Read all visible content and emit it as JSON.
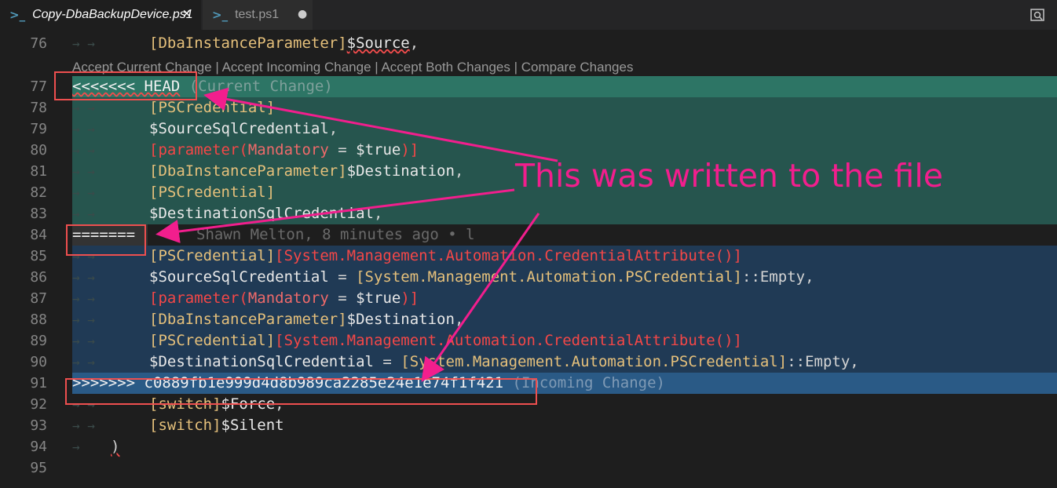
{
  "tabs": [
    {
      "icon": "powershell-icon",
      "title": "Copy-DbaBackupDevice.ps1",
      "close": "✕"
    },
    {
      "icon": "powershell-icon",
      "title": "test.ps1",
      "dirty": "●"
    }
  ],
  "codelens": "Accept Current Change | Accept Incoming Change | Accept Both Changes | Compare Changes",
  "lines": {
    "l76": {
      "num": "76",
      "type": "[DbaInstanceParameter]",
      "var": "$Source",
      "tail": ","
    },
    "l77": {
      "num": "77",
      "marker": "<<<<<<< HEAD",
      "label": "(Current Change)"
    },
    "l78": {
      "num": "78",
      "type": "[PSCredential]"
    },
    "l79": {
      "num": "79",
      "var": "$SourceSqlCredential",
      "tail": ","
    },
    "l80": {
      "num": "80",
      "open": "[parameter(",
      "param": "Mandatory",
      "mid": " = ",
      "var": "$true",
      "close": ")]"
    },
    "l81": {
      "num": "81",
      "type": "[DbaInstanceParameter]",
      "var": "$Destination",
      "tail": ","
    },
    "l82": {
      "num": "82",
      "type": "[PSCredential]"
    },
    "l83": {
      "num": "83",
      "var": "$DestinationSqlCredential",
      "tail": ","
    },
    "l84": {
      "num": "84",
      "marker": "=======",
      "blame": "Shawn Melton, 8 minutes ago • l"
    },
    "l85": {
      "num": "85",
      "type": "[PSCredential]",
      "attr": "[System.Management.Automation.CredentialAttribute()]"
    },
    "l86": {
      "num": "86",
      "var": "$SourceSqlCredential",
      "mid": " = ",
      "type": "[System.Management.Automation.PSCredential]",
      "tail": "::Empty,"
    },
    "l87": {
      "num": "87",
      "open": "[parameter(",
      "param": "Mandatory",
      "mid": " = ",
      "var": "$true",
      "close": ")]"
    },
    "l88": {
      "num": "88",
      "type": "[DbaInstanceParameter]",
      "var": "$Destination",
      "tail": ","
    },
    "l89": {
      "num": "89",
      "type": "[PSCredential]",
      "attr": "[System.Management.Automation.CredentialAttribute()]"
    },
    "l90": {
      "num": "90",
      "var": "$DestinationSqlCredential",
      "mid": " = ",
      "type": "[System.Management.Automation.PSCredential]",
      "tail": "::Empty,"
    },
    "l91": {
      "num": "91",
      "marker": ">>>>>>> c0889fb1e999d4d8b989ca2285e24e1e74f1f421",
      "label": "(Incoming Change)"
    },
    "l92": {
      "num": "92",
      "type": "[switch]",
      "var": "$Force",
      "tail": ","
    },
    "l93": {
      "num": "93",
      "type": "[switch]",
      "var": "$Silent"
    },
    "l94": {
      "num": "94",
      "close": ")"
    },
    "l95": {
      "num": "95"
    }
  },
  "annotation": {
    "text": "This was written to the file",
    "color": "#f21e8d",
    "box_color": "#ee4f4f"
  },
  "colors": {
    "current_header": "#2d7565",
    "current_body": "#26554e",
    "incoming_header": "#2a5a86",
    "incoming_body": "#203a55",
    "type": "#e5c07b",
    "attribute": "#f44747"
  }
}
